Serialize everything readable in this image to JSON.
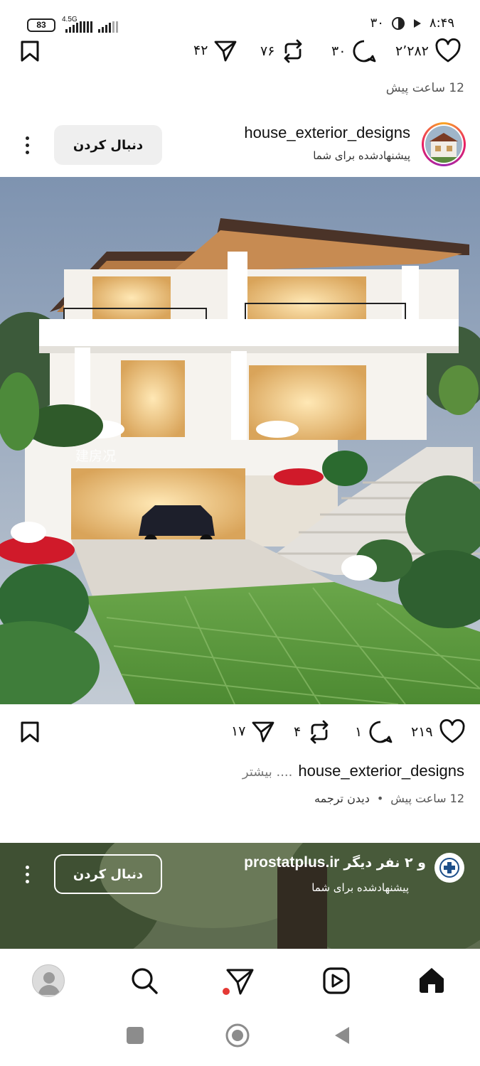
{
  "status": {
    "battery": "83",
    "network": "4.5G",
    "time": "۸:۴۹",
    "extra": "۳۰"
  },
  "top_actions": {
    "likes": "۲٬۲۸۲",
    "comments": "۳۰",
    "reposts": "۷۶",
    "shares": "۴۲"
  },
  "top_time": "12 ساعت پیش",
  "post": {
    "username": "house_exterior_designs",
    "suggested": "پیشنهادشده برای شما",
    "follow_label": "دنبال کردن",
    "watermark": "建房况",
    "likes": "۲۱۹",
    "comments": "۱",
    "reposts": "۴",
    "shares": "۱۷",
    "caption_user": "house_exterior_designs",
    "caption_more": ".... بیشتر",
    "time": "12 ساعت پیش",
    "separator": "•",
    "translate": "دیدن ترجمه"
  },
  "next_post": {
    "username": "prostatplus.ir",
    "others": "و ۲ نفر دیگر",
    "suggested": "پیشنهادشده برای شما",
    "follow_label": "دنبال کردن"
  },
  "nav": {
    "items": [
      "profile-icon",
      "search-icon",
      "send-icon",
      "reels-icon",
      "home-icon"
    ]
  },
  "colors": {
    "notification_dot": "#e53935",
    "story_ring_start": "#f9a825",
    "story_ring_end": "#e91e63"
  }
}
